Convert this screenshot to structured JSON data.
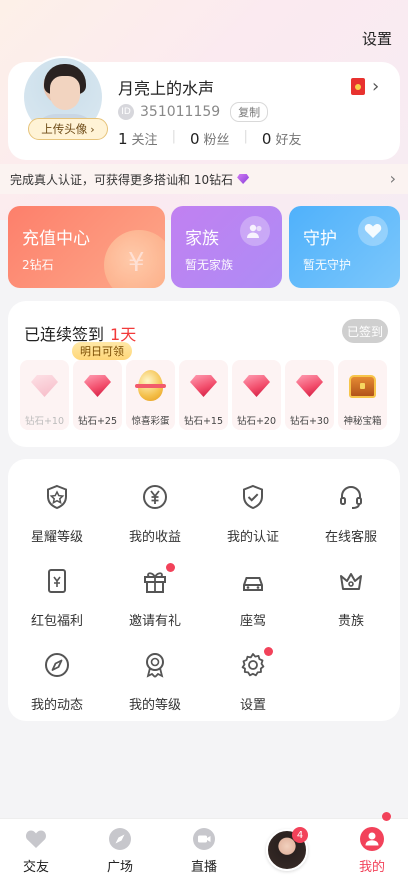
{
  "header": {
    "settings_label": "设置"
  },
  "profile": {
    "nickname": "月亮上的水声",
    "id_prefix": "ID",
    "id_value": "351011159",
    "copy_label": "复制",
    "upload_avatar_label": "上传头像",
    "stats": [
      {
        "count": "1",
        "label": "关注"
      },
      {
        "count": "0",
        "label": "粉丝"
      },
      {
        "count": "0",
        "label": "好友"
      }
    ]
  },
  "verify_banner": {
    "text": "完成真人认证，可获得更多搭讪和 10钻石"
  },
  "cards": {
    "recharge": {
      "title": "充值中心",
      "subtitle": "2钻石",
      "color": "#fd7f6b"
    },
    "family": {
      "title": "家族",
      "subtitle": "暂无家族",
      "color": "#c180f1"
    },
    "guard": {
      "title": "守护",
      "subtitle": "暂无守护",
      "color": "#4fb1fb"
    }
  },
  "checkin": {
    "title_prefix": "已连续签到",
    "days_value": "1天",
    "signed_label": "已签到",
    "tomorrow_label": "明日可领",
    "days": [
      {
        "label": "钻石+10",
        "icon": "diamond-icon",
        "faded": true
      },
      {
        "label": "钻石+25",
        "icon": "diamond-icon",
        "faded": false
      },
      {
        "label": "惊喜彩蛋",
        "icon": "egg-icon",
        "faded": false
      },
      {
        "label": "钻石+15",
        "icon": "diamond-icon",
        "faded": false
      },
      {
        "label": "钻石+20",
        "icon": "diamond-icon",
        "faded": false
      },
      {
        "label": "钻石+30",
        "icon": "diamond-icon",
        "faded": false
      },
      {
        "label": "神秘宝箱",
        "icon": "treasure-chest-icon",
        "faded": false
      }
    ]
  },
  "menu": {
    "items": [
      {
        "label": "星耀等级",
        "icon": "shield-star-icon",
        "dot": false
      },
      {
        "label": "我的收益",
        "icon": "yuan-coin-icon",
        "dot": false
      },
      {
        "label": "我的认证",
        "icon": "shield-check-icon",
        "dot": false
      },
      {
        "label": "在线客服",
        "icon": "headset-icon",
        "dot": false
      },
      {
        "label": "红包福利",
        "icon": "red-envelope-icon",
        "dot": false
      },
      {
        "label": "邀请有礼",
        "icon": "gift-icon",
        "dot": true
      },
      {
        "label": "座驾",
        "icon": "car-icon",
        "dot": false
      },
      {
        "label": "贵族",
        "icon": "crown-icon",
        "dot": false
      },
      {
        "label": "我的动态",
        "icon": "compass-icon",
        "dot": false
      },
      {
        "label": "我的等级",
        "icon": "medal-icon",
        "dot": false
      },
      {
        "label": "设置",
        "icon": "gear-icon",
        "dot": true
      }
    ]
  },
  "tabbar": {
    "tabs": [
      {
        "label": "交友",
        "icon": "heart-icon"
      },
      {
        "label": "广场",
        "icon": "compass-icon"
      },
      {
        "label": "直播",
        "icon": "video-icon"
      },
      {
        "label": "我的",
        "icon": "person-icon"
      }
    ],
    "center_badge": "4",
    "accent_color": "#f2425a"
  }
}
